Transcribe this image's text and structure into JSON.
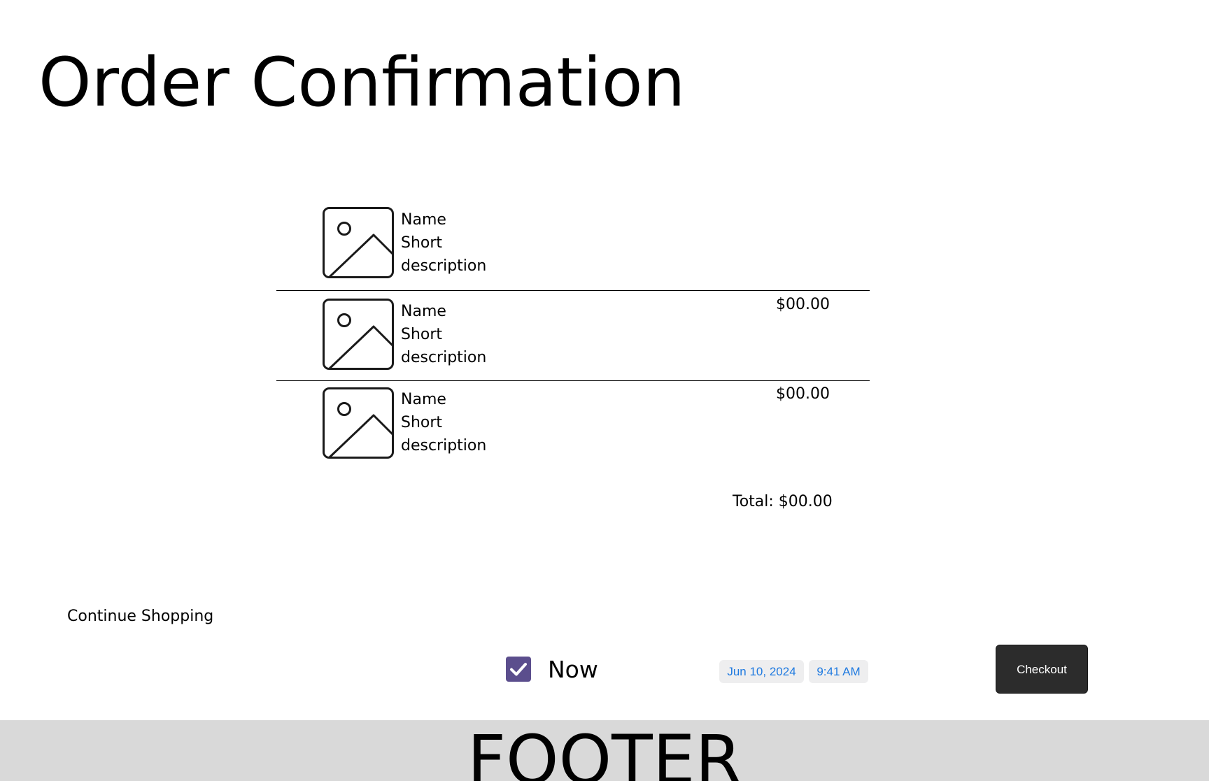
{
  "page": {
    "title": "Order Confirmation"
  },
  "order": {
    "items": [
      {
        "name": "Name",
        "description_line1": "Short",
        "description_line2": "description",
        "price": "",
        "thumbnail_icon": "image-placeholder-icon"
      },
      {
        "name": "Name",
        "description_line1": "Short",
        "description_line2": "description",
        "price": "$00.00",
        "thumbnail_icon": "image-placeholder-icon"
      },
      {
        "name": "Name",
        "description_line1": "Short",
        "description_line2": "description",
        "price": "$00.00",
        "thumbnail_icon": "image-placeholder-icon"
      }
    ],
    "total_label": "Total: $00.00"
  },
  "actions": {
    "continue_shopping_label": "Continue Shopping",
    "checkout_label": "Checkout"
  },
  "schedule": {
    "now_label": "Now",
    "now_checked": true,
    "date": "Jun 10, 2024",
    "time": "9:41 AM"
  },
  "footer": {
    "text": "FOOTER"
  },
  "colors": {
    "checkbox": "#5b4e8d",
    "chip_text": "#1f7ae0",
    "chip_bg": "#eeeeef",
    "checkout_bg": "#2c2c2c",
    "footer_bg": "#d9d9d9"
  }
}
